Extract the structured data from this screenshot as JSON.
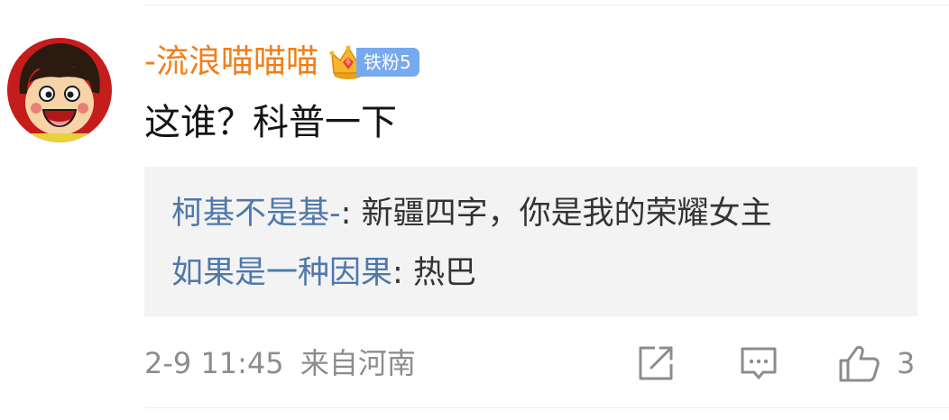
{
  "comment": {
    "username": "-流浪喵喵喵",
    "fan_badge": "铁粉5",
    "text": "这谁？科普一下",
    "timestamp": "2-9 11:45",
    "location": "来自河南",
    "like_count": "3"
  },
  "replies": [
    {
      "author": "柯基不是基-",
      "separator": ": ",
      "text": "新疆四字，你是我的荣耀女主"
    },
    {
      "author": "如果是一种因果",
      "separator": ": ",
      "text": "热巴"
    }
  ],
  "colors": {
    "username": "#f07f1a",
    "reply_author": "#4f78ab",
    "badge": "#77a9ee",
    "meta": "#8c8c8c"
  },
  "icons": {
    "avatar": "cartoon-boy-avatar",
    "badge": "crown-icon",
    "share": "share-icon",
    "comment": "comment-icon",
    "like": "thumbs-up-icon"
  }
}
